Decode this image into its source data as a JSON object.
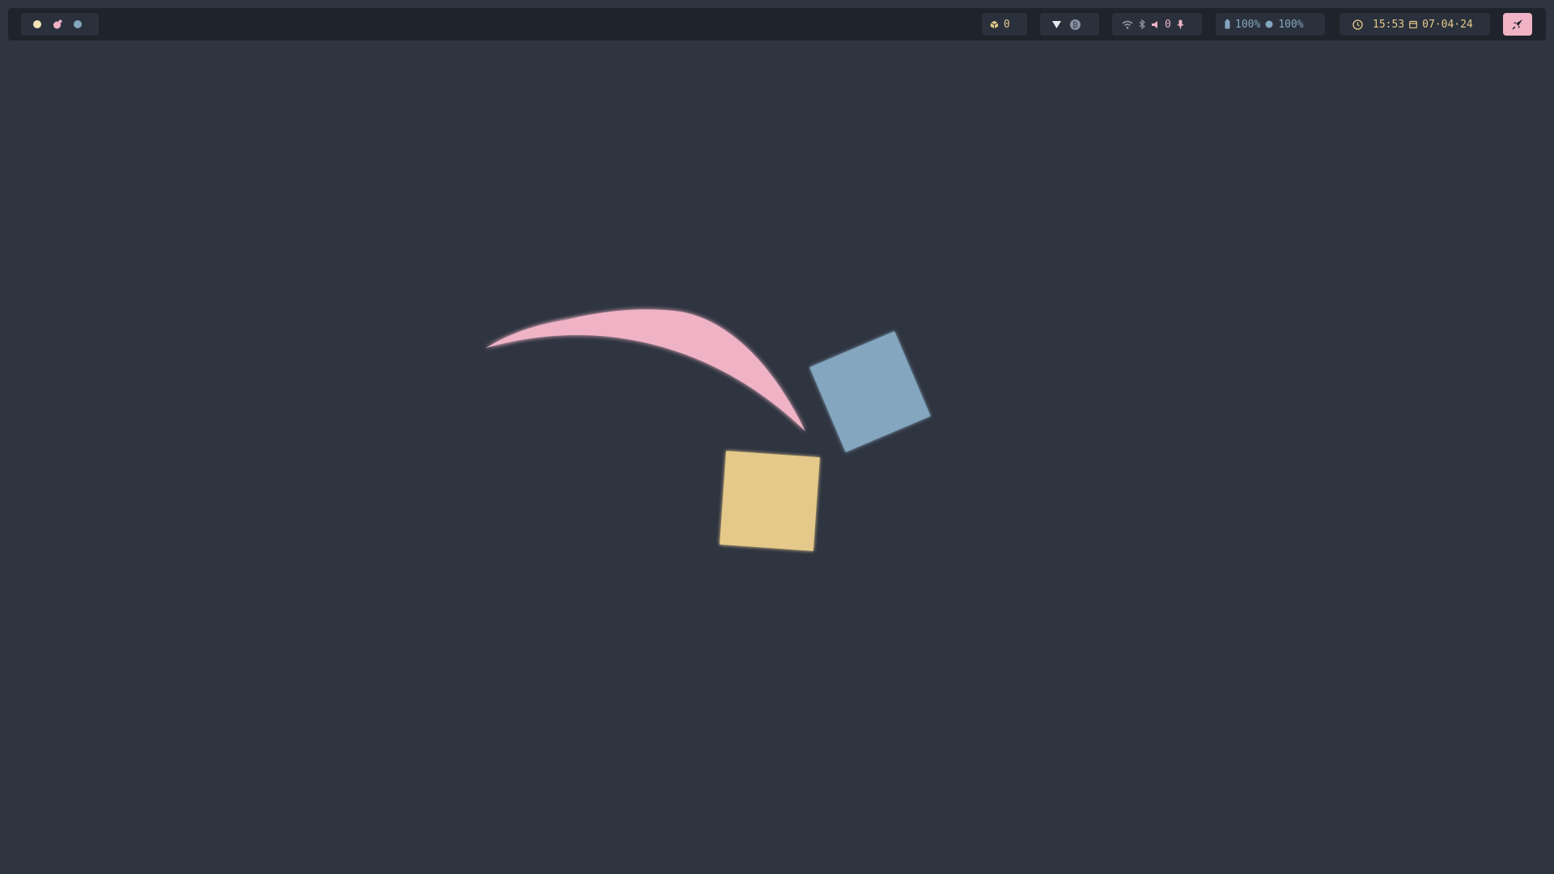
{
  "colors": {
    "background": "#2e3440",
    "bar": "#1f232b",
    "module": "#2b313c",
    "yellow": "#e5c98a",
    "pink": "#f0b3c6",
    "blue": "#84a6bf",
    "muted": "#8a93a4",
    "white": "#e8eaee"
  },
  "workspaces": [
    {
      "name": "workspace-1",
      "color": "#f3e3b5"
    },
    {
      "name": "workspace-2",
      "color": "#f0b3c6"
    },
    {
      "name": "workspace-3",
      "color": "#84a6bf"
    }
  ],
  "updates": {
    "icon": "package-icon",
    "count": "0"
  },
  "tray": {
    "icons": [
      "vpn-icon",
      "bitcoin-icon"
    ]
  },
  "connectivity": {
    "icons": [
      "wifi-icon",
      "bluetooth-icon",
      "volume-icon",
      "microphone-icon"
    ],
    "volume": "0"
  },
  "battery": {
    "icons": [
      "battery-icon",
      "circle-icon"
    ],
    "primary": "100%",
    "secondary": "100%"
  },
  "clock": {
    "icons": [
      "clock-icon",
      "calendar-icon"
    ],
    "time": "15:53",
    "date": "07·04·24"
  },
  "launcher": {
    "icon": "rocket-icon",
    "color": "#f0b3c6"
  },
  "wallpaper": {
    "shapes": [
      "crescent-shape",
      "blue-square-shape",
      "yellow-square-shape"
    ]
  }
}
